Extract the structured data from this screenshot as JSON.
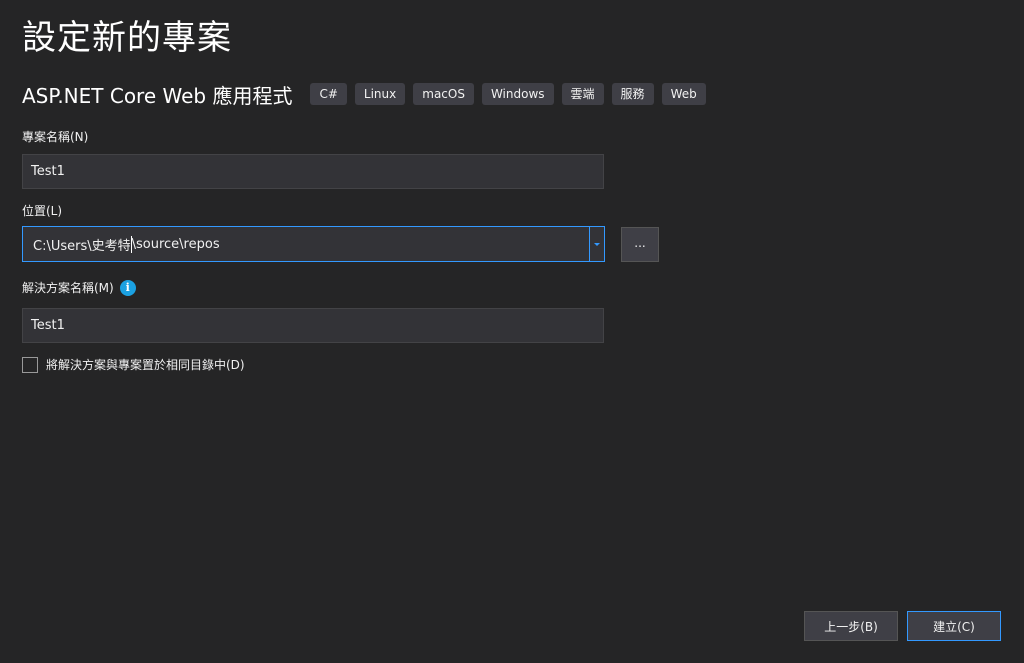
{
  "page": {
    "title": "設定新的專案"
  },
  "template": {
    "name": "ASP.NET Core Web 應用程式",
    "tags": [
      "C#",
      "Linux",
      "macOS",
      "Windows",
      "雲端",
      "服務",
      "Web"
    ]
  },
  "project_name": {
    "label": "專案名稱(N)",
    "value": "Test1"
  },
  "location": {
    "label": "位置(L)",
    "value_before_caret": "C:\\Users\\史考特",
    "value_after_caret": "\\source\\repos",
    "browse_label": "..."
  },
  "solution_name": {
    "label": "解決方案名稱(M)",
    "info_icon": "info-icon",
    "value": "Test1"
  },
  "same_directory": {
    "label": "將解決方案與專案置於相同目錄中(D)",
    "checked": false
  },
  "footer": {
    "back_label": "上一步(B)",
    "create_label": "建立(C)"
  },
  "colors": {
    "background": "#252526",
    "input_background": "#333337",
    "accent": "#3399ff",
    "info": "#1ba1e2",
    "tag_background": "#3f3f46"
  }
}
